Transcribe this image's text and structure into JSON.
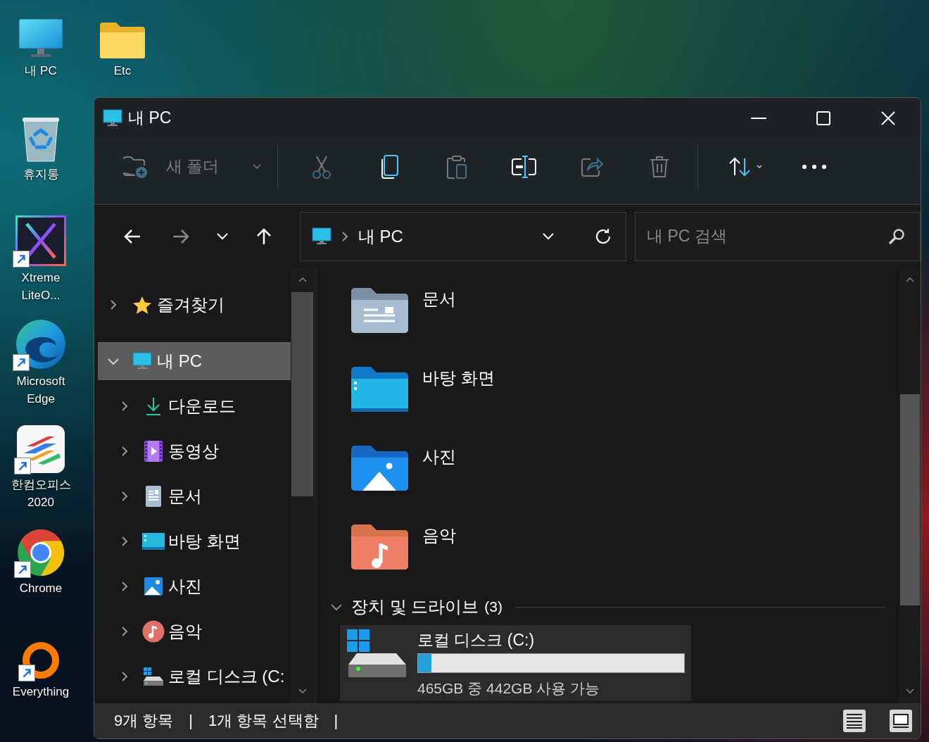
{
  "desktop_icons": [
    {
      "kind": "pc",
      "label": "내 PC",
      "shortcut": false
    },
    {
      "kind": "recycle_bin",
      "label": "휴지통",
      "shortcut": false
    },
    {
      "kind": "xtreme",
      "label": "Xtreme LiteO...",
      "shortcut": true
    },
    {
      "kind": "edge",
      "label": "Microsoft Edge",
      "shortcut": true
    },
    {
      "kind": "hancom",
      "label": "한컴오피스 2020",
      "shortcut": true
    },
    {
      "kind": "chrome",
      "label": "Chrome",
      "shortcut": true
    },
    {
      "kind": "everything",
      "label": "Everything",
      "shortcut": true
    },
    {
      "kind": "folder",
      "label": "Etc",
      "shortcut": false
    }
  ],
  "window": {
    "title": "내 PC"
  },
  "toolbar": {
    "new_folder": {
      "label": "새 폴더",
      "disabled": true
    },
    "actions": [
      {
        "kind": "cut",
        "disabled": true
      },
      {
        "kind": "copy",
        "disabled": false
      },
      {
        "kind": "paste",
        "disabled": true
      },
      {
        "kind": "rename",
        "disabled": false
      },
      {
        "kind": "share",
        "disabled": true
      },
      {
        "kind": "delete",
        "disabled": true
      }
    ]
  },
  "navigation": {
    "back_disabled": false,
    "forward_disabled": true
  },
  "address_bar": {
    "path": [
      "내 PC"
    ]
  },
  "search": {
    "placeholder": "내 PC 검색"
  },
  "sidebar": {
    "items": [
      {
        "kind": "favorites",
        "label": "즐겨찾기",
        "selected": false,
        "expanded": false
      },
      {
        "kind": "pc",
        "label": "내 PC",
        "selected": true,
        "expanded": true,
        "children": [
          {
            "kind": "download",
            "label": "다운로드",
            "selected": false,
            "expanded": false
          },
          {
            "kind": "video",
            "label": "동영상",
            "selected": false,
            "expanded": false
          },
          {
            "kind": "documents",
            "label": "문서",
            "selected": false,
            "expanded": false
          },
          {
            "kind": "desktop",
            "label": "바탕 화면",
            "selected": false,
            "expanded": false
          },
          {
            "kind": "pictures",
            "label": "사진",
            "selected": false,
            "expanded": false
          },
          {
            "kind": "music",
            "label": "음악",
            "selected": false,
            "expanded": false
          },
          {
            "kind": "drive",
            "label": "로컬 디스크 (C:",
            "selected": false,
            "expanded": false
          }
        ]
      }
    ]
  },
  "folders": [
    {
      "kind": "documents",
      "name": "문서"
    },
    {
      "kind": "desktop",
      "name": "바탕 화면"
    },
    {
      "kind": "pictures",
      "name": "사진"
    },
    {
      "kind": "music",
      "name": "음악"
    }
  ],
  "drives_section": {
    "title": "장치 및 드라이브",
    "count": "(3)",
    "expanded": true
  },
  "drives": [
    {
      "name": "로컬 디스크 (C:)",
      "level": 0.05,
      "reading": "465GB 중 442GB 사용 가능"
    }
  ],
  "status_bar": {
    "texts": [
      "9개 항목",
      "|",
      "1개 항목 선택함",
      "|"
    ],
    "views": [
      {
        "kind": "details"
      },
      {
        "kind": "tiles"
      }
    ]
  }
}
